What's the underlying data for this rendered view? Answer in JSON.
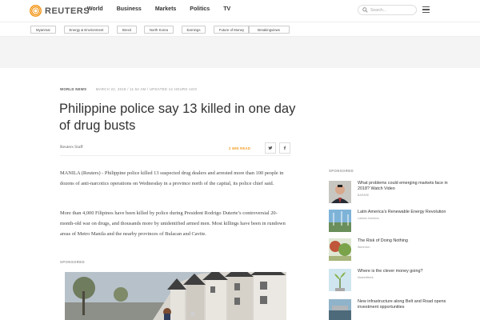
{
  "header": {
    "logo_text": "REUTERS",
    "nav": [
      "World",
      "Business",
      "Markets",
      "Politics",
      "TV"
    ],
    "search_placeholder": "Search..."
  },
  "topics": [
    "Myanmar",
    "Energy & Environment",
    "Brexit",
    "North Korea",
    "Earnings",
    "Future of Money",
    "Breakingviews"
  ],
  "article": {
    "section": "WORLD NEWS",
    "timestamp": "MARCH 22, 2018 / 11:52 AM / UPDATED 14 HOURS AGO",
    "title": "Philippine police say 13 killed in one day of drug busts",
    "byline": "Reuters Staff",
    "read_time": "2 MIN READ",
    "paragraphs": [
      "MANILA (Reuters) - Philippine police killed 13 suspected drug dealers and arrested more than 100 people in dozens of anti-narcotics operations on Wednesday in a province north of the capital, its police chief said.",
      "More than 4,000 Filipinos have been killed by police during President Rodrigo Duterte’s controversial 20-month-old war on drugs, and thousands more by unidentified armed men. Most killings have been in rundown areas of Metro Manila and the nearby provinces of Bulacan and Cavite."
    ],
    "sponsored_label": "SPONSORED"
  },
  "sidebar": {
    "label": "SPONSORED",
    "items": [
      {
        "title": "What problems could emerging markets face in 2018? Watch Video",
        "source": "BARARE"
      },
      {
        "title": "Latin America's Renewable Energy Revolution",
        "source": "Latham Investors"
      },
      {
        "title": "The Risk of Doing Nothing",
        "source": "Wavenion"
      },
      {
        "title": "Where is the clever money going?",
        "source": "MarketWeek"
      },
      {
        "title": "New infrastructure along Belt and Road opens investment opportunities",
        "source": ""
      }
    ]
  },
  "colors": {
    "accent": "#f39a1f",
    "text": "#333333",
    "muted": "#999999"
  }
}
